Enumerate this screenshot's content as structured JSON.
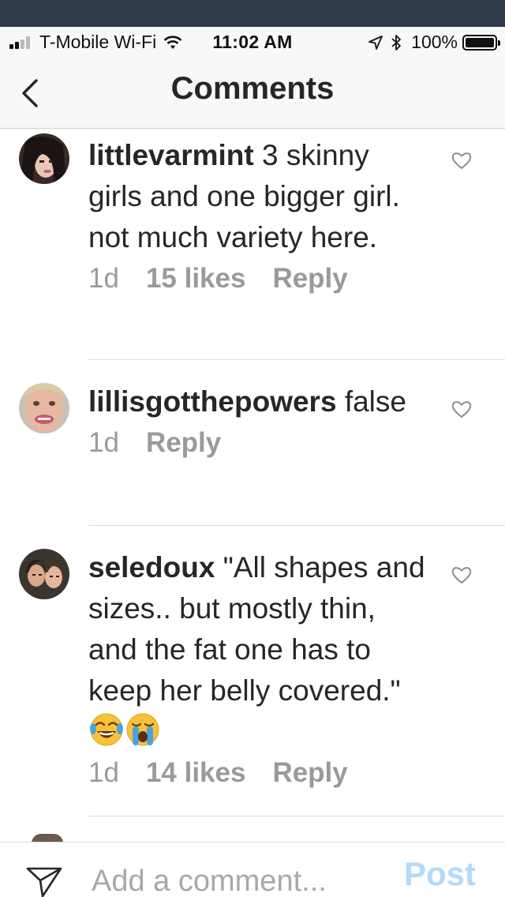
{
  "status_bar": {
    "carrier": "T-Mobile Wi-Fi",
    "time": "11:02 AM",
    "battery": "100%"
  },
  "nav": {
    "title": "Comments"
  },
  "comments": [
    {
      "username": "littlevarmint",
      "text": "3 skinny girls and one bigger girl. not much variety here.",
      "time": "1d",
      "likes": "15 likes",
      "reply": "Reply"
    },
    {
      "username": "lillisgotthepowers",
      "text": "false",
      "time": "1d",
      "reply": "Reply"
    },
    {
      "username": "seledoux",
      "text": "\"All shapes and sizes.. but mostly thin, and the fat one has to keep her belly covered.\"",
      "time": "1d",
      "likes": "14 likes",
      "reply": "Reply",
      "emojis": [
        "face-with-tears-of-joy",
        "loudly-crying-face"
      ]
    }
  ],
  "composer": {
    "placeholder": "Add a comment...",
    "post_label": "Post"
  },
  "colors": {
    "status_strip": "#2f3a4a",
    "text": "#262626",
    "meta": "#9a9a9a",
    "post_disabled": "#b3d9fb"
  }
}
